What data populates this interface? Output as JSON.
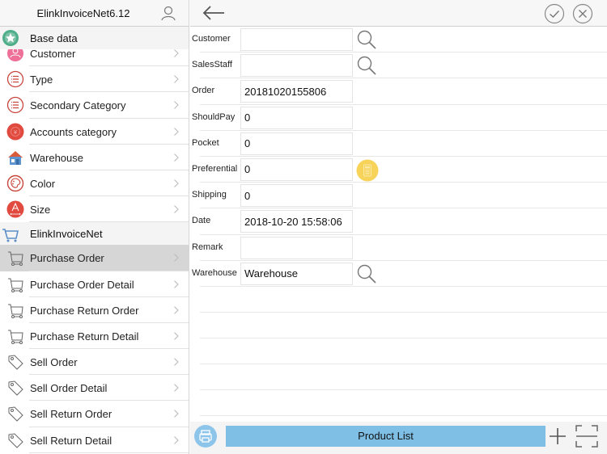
{
  "sidebar": {
    "title": "ElinkInvoiceNet6.12",
    "sections": [
      {
        "label": "Base data",
        "icon": "star-badge-icon",
        "items": [
          {
            "label": "Customer",
            "icon": "customer-icon"
          },
          {
            "label": "Type",
            "icon": "list-icon"
          },
          {
            "label": "Secondary Category",
            "icon": "list-icon"
          },
          {
            "label": "Accounts category",
            "icon": "yuan-icon"
          },
          {
            "label": "Warehouse",
            "icon": "house-icon"
          },
          {
            "label": "Color",
            "icon": "palette-icon"
          },
          {
            "label": "Size",
            "icon": "size-icon"
          }
        ]
      },
      {
        "label": "ElinkInvoiceNet",
        "icon": "shopping-cart-icon",
        "items": [
          {
            "label": "Purchase Order",
            "icon": "cart-icon",
            "active": true
          },
          {
            "label": "Purchase Order Detail",
            "icon": "cart-icon"
          },
          {
            "label": "Purchase Return Order",
            "icon": "cart-icon"
          },
          {
            "label": "Purchase Return Detail",
            "icon": "cart-icon"
          },
          {
            "label": "Sell Order",
            "icon": "tag-icon"
          },
          {
            "label": "Sell Order Detail",
            "icon": "tag-icon"
          },
          {
            "label": "Sell Return Order",
            "icon": "tag-icon"
          },
          {
            "label": "Sell Return Detail",
            "icon": "tag-icon"
          }
        ]
      }
    ]
  },
  "form": {
    "fields": [
      {
        "label": "Customer",
        "value": "",
        "action": "search"
      },
      {
        "label": "SalesStaff",
        "value": "",
        "action": "search"
      },
      {
        "label": "Order",
        "value": "20181020155806",
        "action": ""
      },
      {
        "label": "ShouldPay",
        "value": "0",
        "action": ""
      },
      {
        "label": "Pocket",
        "value": "0",
        "action": ""
      },
      {
        "label": "Preferential",
        "value": "0",
        "action": "calculator"
      },
      {
        "label": "Shipping",
        "value": "0",
        "action": ""
      },
      {
        "label": "Date",
        "value": "2018-10-20 15:58:06",
        "action": ""
      },
      {
        "label": "Remark",
        "value": "",
        "action": ""
      },
      {
        "label": "Warehouse",
        "value": "Warehouse",
        "action": "search"
      }
    ]
  },
  "bottom_bar": {
    "product_list_label": "Product List"
  },
  "colors": {
    "accent_blue": "#7fbfe5",
    "calculator_yellow": "#f7d35a",
    "badge_green": "#4fae8a",
    "icon_red": "#e04a3f",
    "icon_pink": "#ee6f98"
  }
}
